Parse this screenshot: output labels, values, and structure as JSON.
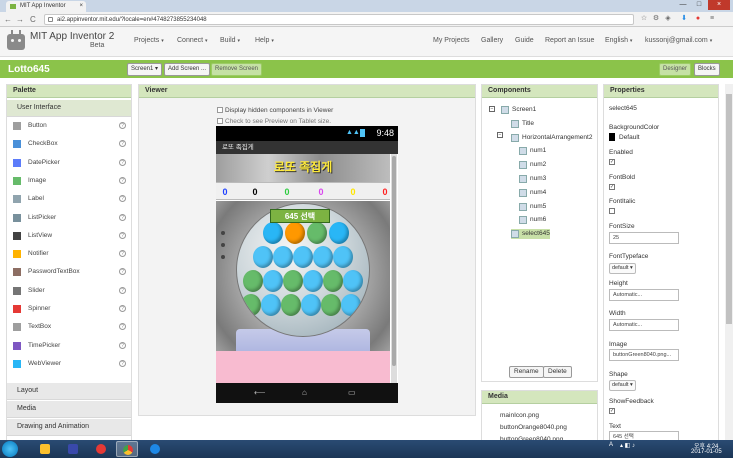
{
  "browser": {
    "tab_title": "MIT App Inventor",
    "tab_close": "×",
    "url": "ai2.appinventor.mit.edu/?locale=en#4748273855234048",
    "back": "←",
    "forward": "→",
    "reload": "C",
    "minimize": "—",
    "maximize": "□",
    "close": "×"
  },
  "header": {
    "brand": "MIT App Inventor 2",
    "brand_sub": "Beta",
    "menus": [
      "Projects",
      "Connect",
      "Build",
      "Help"
    ],
    "right_links": [
      "My Projects",
      "Gallery",
      "Guide",
      "Report an Issue",
      "English",
      "kussonj@gmail.com"
    ],
    "caret": "▾"
  },
  "toolbar": {
    "project_name": "Lotto645",
    "screen_select": "Screen1 ▾",
    "add_screen": "Add Screen ...",
    "remove_screen": "Remove Screen",
    "designer": "Designer",
    "blocks": "Blocks"
  },
  "palette": {
    "title": "Palette",
    "section_open": "User Interface",
    "help": "?",
    "items": [
      {
        "label": "Button",
        "icon": "button-icon",
        "color": "#9e9e9e"
      },
      {
        "label": "CheckBox",
        "icon": "checkbox-icon",
        "color": "#4a90d9"
      },
      {
        "label": "DatePicker",
        "icon": "datepicker-icon",
        "color": "#5c7cfa"
      },
      {
        "label": "Image",
        "icon": "image-icon",
        "color": "#66bb6a"
      },
      {
        "label": "Label",
        "icon": "label-icon",
        "color": "#90a4ae"
      },
      {
        "label": "ListPicker",
        "icon": "listpicker-icon",
        "color": "#78909c"
      },
      {
        "label": "ListView",
        "icon": "listview-icon",
        "color": "#424242"
      },
      {
        "label": "Notifier",
        "icon": "notifier-icon",
        "color": "#ffb300"
      },
      {
        "label": "PasswordTextBox",
        "icon": "password-icon",
        "color": "#8d6e63"
      },
      {
        "label": "Slider",
        "icon": "slider-icon",
        "color": "#757575"
      },
      {
        "label": "Spinner",
        "icon": "spinner-icon",
        "color": "#e53935"
      },
      {
        "label": "TextBox",
        "icon": "textbox-icon",
        "color": "#9e9e9e"
      },
      {
        "label": "TimePicker",
        "icon": "timepicker-icon",
        "color": "#7e57c2"
      },
      {
        "label": "WebViewer",
        "icon": "webviewer-icon",
        "color": "#29b6f6"
      }
    ],
    "sections": [
      "Layout",
      "Media",
      "Drawing and Animation"
    ]
  },
  "viewer": {
    "title": "Viewer",
    "display_hidden": "Display hidden components in Viewer",
    "tablet_preview": "Check to see Preview on Tablet size.",
    "phone": {
      "clock": "9:48",
      "screen_title": "로또 족집게",
      "title_image_text": "로또 족집게",
      "numbers": [
        {
          "value": "0",
          "color": "#1e40ff"
        },
        {
          "value": "0",
          "color": "#000000"
        },
        {
          "value": "0",
          "color": "#2ecc40"
        },
        {
          "value": "0",
          "color": "#d946ef"
        },
        {
          "value": "0",
          "color": "#ffe600"
        },
        {
          "value": "0",
          "color": "#ff2020"
        }
      ],
      "select_button": "645 선택",
      "nav": [
        "⟵",
        "⌂",
        "▭"
      ]
    }
  },
  "components": {
    "title": "Components",
    "tree": [
      {
        "label": "Screen1",
        "level": 0
      },
      {
        "label": "Title",
        "level": 1
      },
      {
        "label": "HorizontalArrangement2",
        "level": 1
      },
      {
        "label": "num1",
        "level": 2
      },
      {
        "label": "num2",
        "level": 2
      },
      {
        "label": "num3",
        "level": 2
      },
      {
        "label": "num4",
        "level": 2
      },
      {
        "label": "num5",
        "level": 2
      },
      {
        "label": "num6",
        "level": 2
      },
      {
        "label": "select645",
        "level": 1
      }
    ],
    "rename": "Rename",
    "delete": "Delete",
    "collapse": "−"
  },
  "media": {
    "title": "Media",
    "files": [
      "mainIcon.png",
      "buttonOrange8040.png",
      "buttonGreen8040.png"
    ]
  },
  "properties": {
    "title": "Properties",
    "component": "select645",
    "check": "✓",
    "items": [
      {
        "label": "BackgroundColor",
        "value": "Default"
      },
      {
        "label": "Enabled"
      },
      {
        "label": "FontBold"
      },
      {
        "label": "FontItalic"
      },
      {
        "label": "FontSize",
        "value": "25"
      },
      {
        "label": "FontTypeface",
        "value": "default ▾"
      },
      {
        "label": "Height",
        "value": "Automatic..."
      },
      {
        "label": "Width",
        "value": "Automatic..."
      },
      {
        "label": "Image",
        "value": "buttonGreen8040.png..."
      },
      {
        "label": "Shape",
        "value": "default ▾"
      },
      {
        "label": "ShowFeedback"
      },
      {
        "label": "Text",
        "value": "645 선택"
      }
    ]
  },
  "taskbar": {
    "time": "오후 4:24",
    "date": "2017-01-05",
    "lang": "A"
  }
}
